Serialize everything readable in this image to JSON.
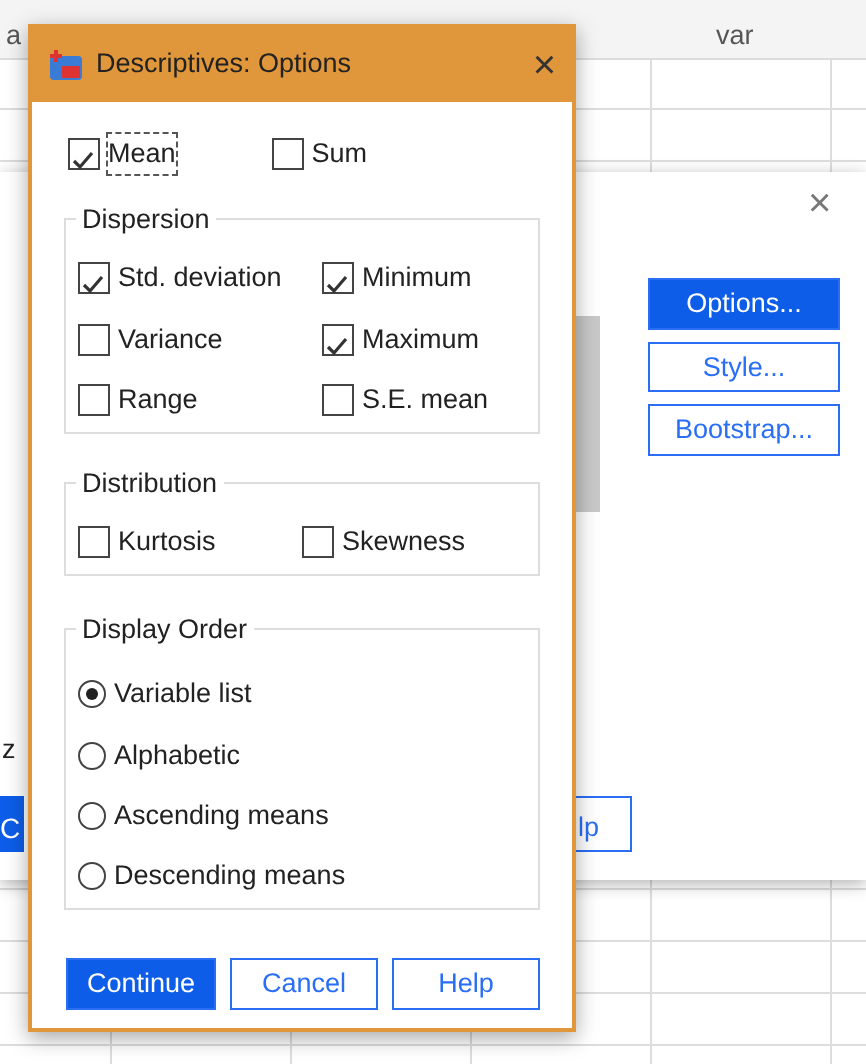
{
  "sheet": {
    "header": [
      "a",
      "var"
    ]
  },
  "back_dialog": {
    "close": "×",
    "cut_label": "z",
    "cut_left_button": "C",
    "cut_help_button": "lp",
    "buttons": [
      {
        "label": "Options...",
        "selected": true
      },
      {
        "label": "Style...",
        "selected": false
      },
      {
        "label": "Bootstrap...",
        "selected": false
      }
    ]
  },
  "dialog": {
    "title": "Descriptives: Options",
    "close": "×",
    "top_options": [
      {
        "label": "Mean",
        "checked": true,
        "focused": true
      },
      {
        "label": "Sum",
        "checked": false,
        "focused": false
      }
    ],
    "groups": [
      {
        "title": "Dispersion",
        "kind": "checkbox",
        "items": [
          {
            "label": "Std. deviation",
            "checked": true
          },
          {
            "label": "Minimum",
            "checked": true
          },
          {
            "label": "Variance",
            "checked": false
          },
          {
            "label": "Maximum",
            "checked": true
          },
          {
            "label": "Range",
            "checked": false
          },
          {
            "label": "S.E. mean",
            "checked": false
          }
        ]
      },
      {
        "title": "Distribution",
        "kind": "checkbox",
        "items": [
          {
            "label": "Kurtosis",
            "checked": false
          },
          {
            "label": "Skewness",
            "checked": false
          }
        ]
      },
      {
        "title": "Display Order",
        "kind": "radio",
        "items": [
          {
            "label": "Variable list",
            "selected": true
          },
          {
            "label": "Alphabetic",
            "selected": false
          },
          {
            "label": "Ascending means",
            "selected": false
          },
          {
            "label": "Descending means",
            "selected": false
          }
        ]
      }
    ],
    "buttons": [
      {
        "label": "Continue",
        "primary": true
      },
      {
        "label": "Cancel",
        "primary": false
      },
      {
        "label": "Help",
        "primary": false
      }
    ]
  }
}
